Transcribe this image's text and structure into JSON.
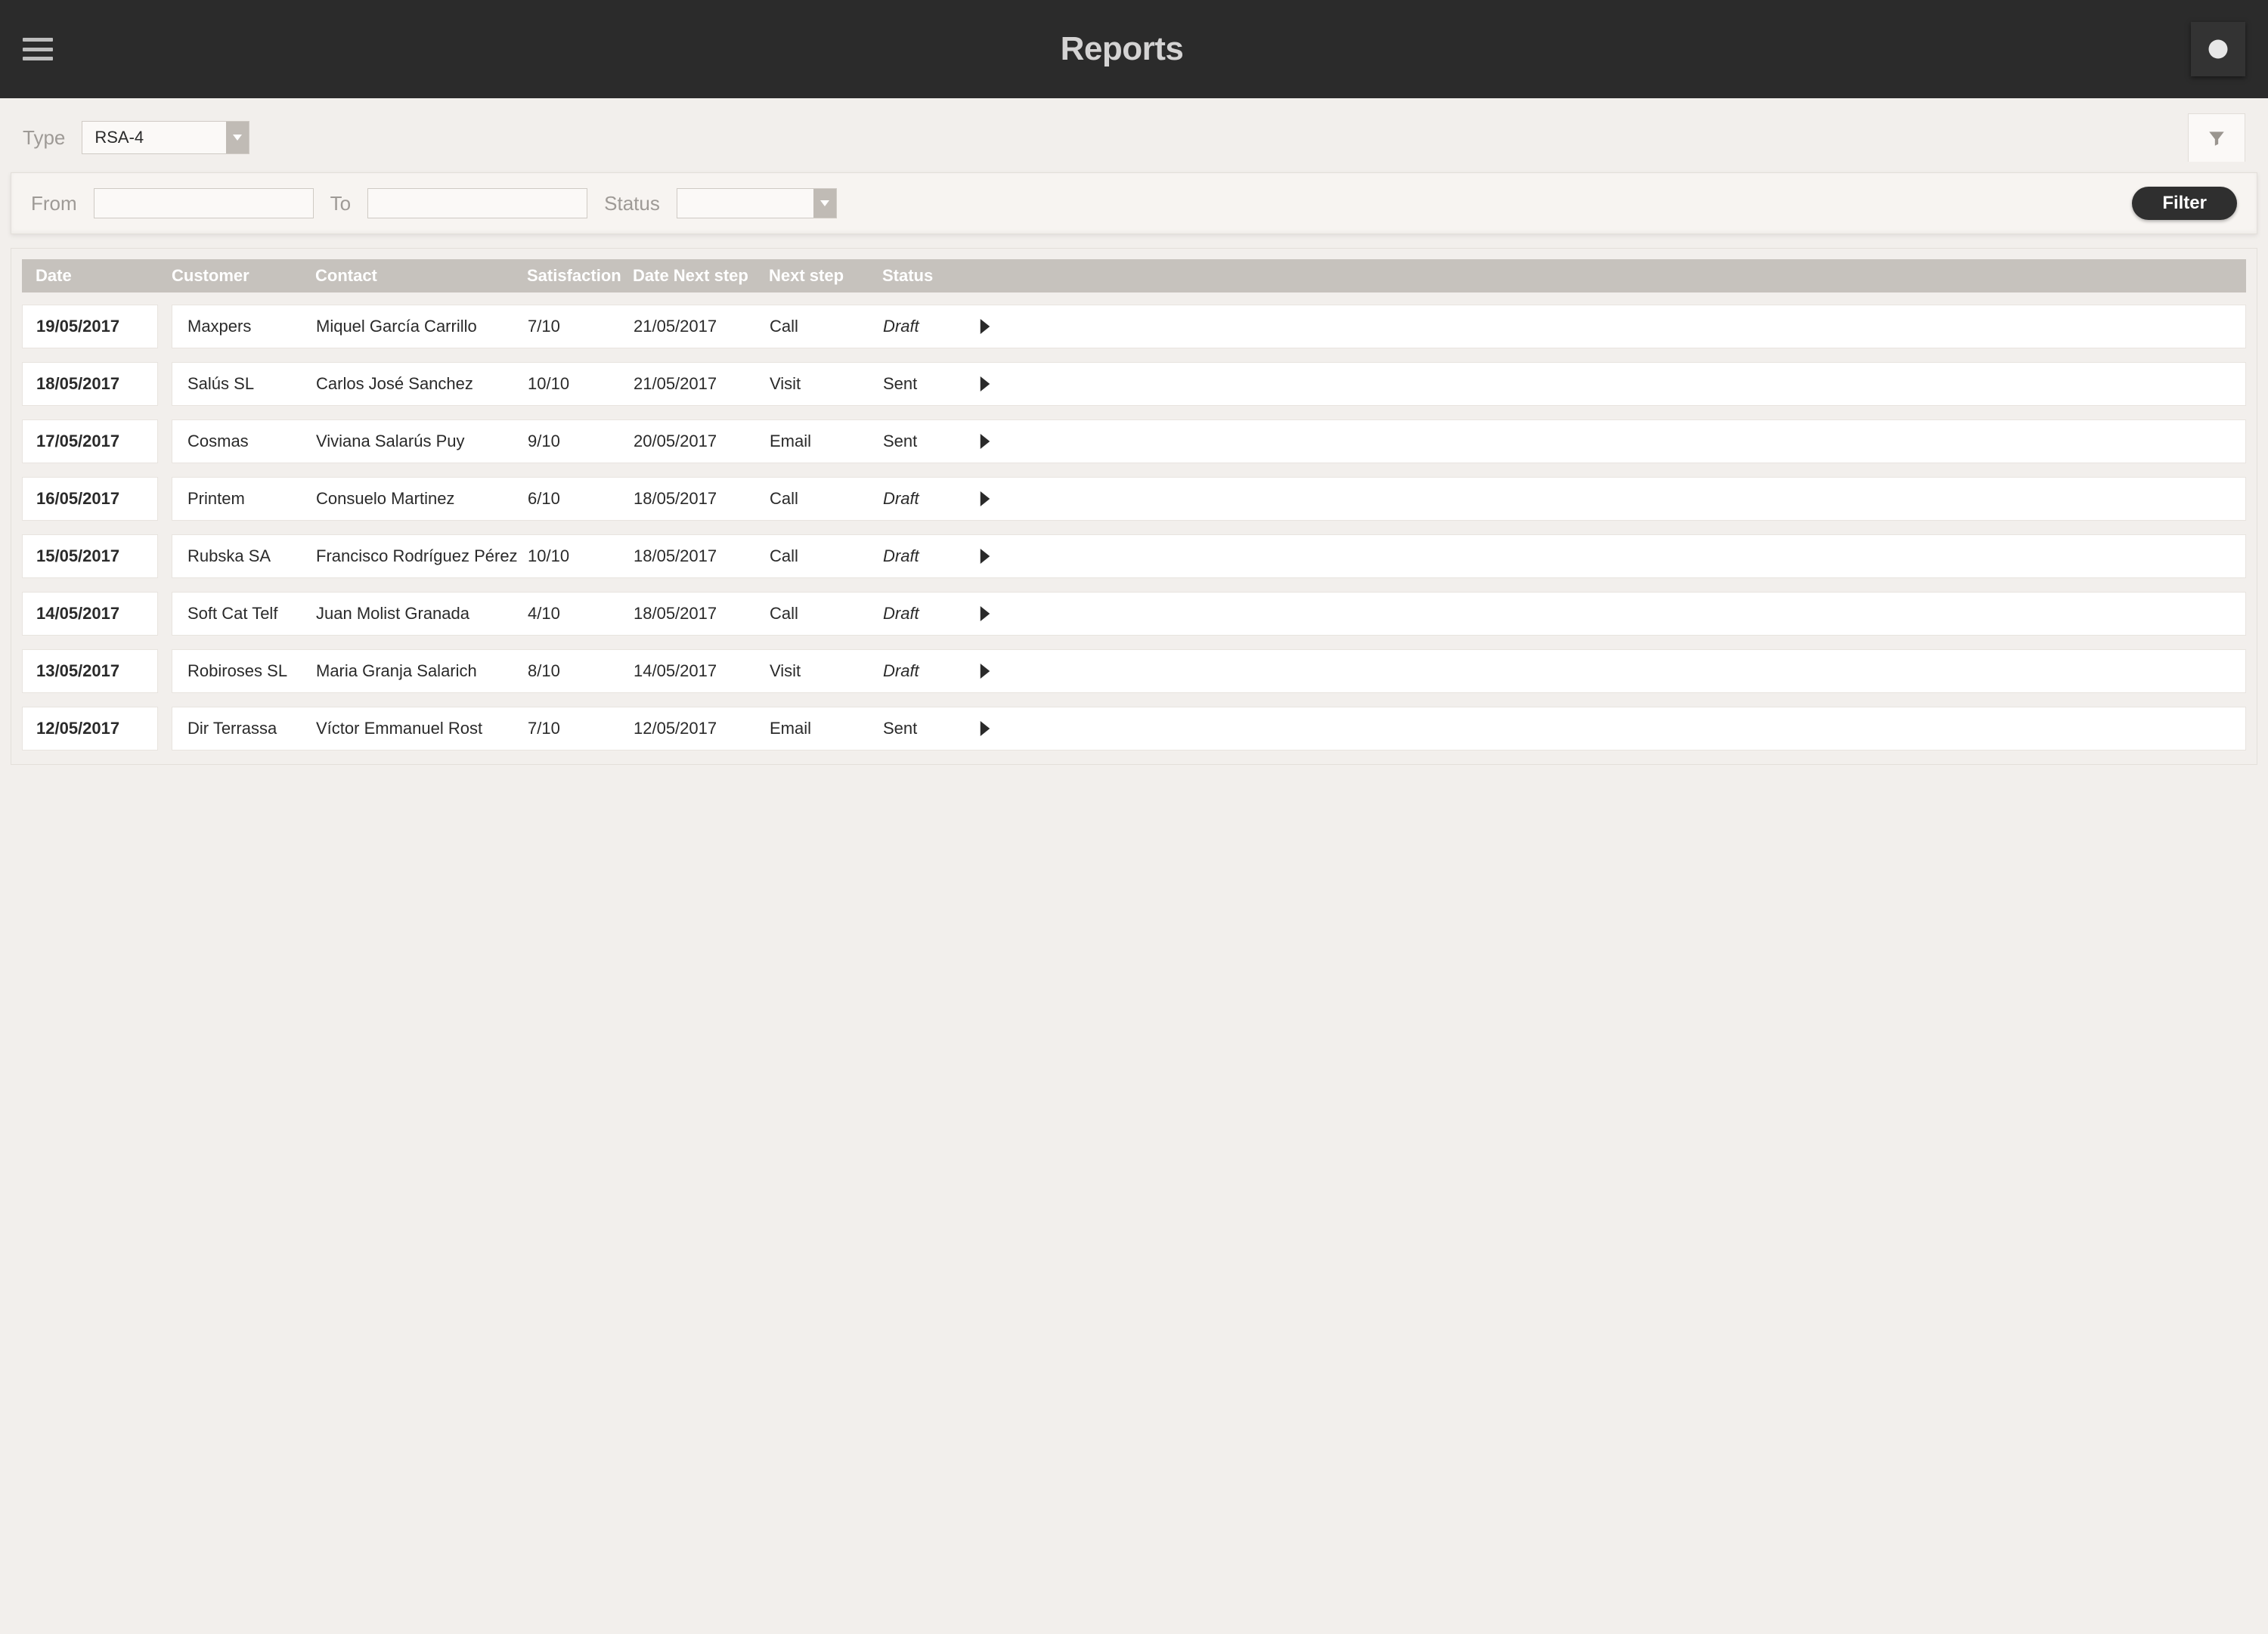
{
  "header": {
    "title": "Reports"
  },
  "type_bar": {
    "label": "Type",
    "value": "RSA-4"
  },
  "filters": {
    "from_label": "From",
    "from_value": "",
    "to_label": "To",
    "to_value": "",
    "status_label": "Status",
    "status_value": "",
    "filter_button": "Filter"
  },
  "columns": {
    "date": "Date",
    "customer": "Customer",
    "contact": "Contact",
    "satisfaction": "Satisfaction",
    "date_next": "Date Next step",
    "next_step": "Next step",
    "status": "Status"
  },
  "rows": [
    {
      "date": "19/05/2017",
      "customer": "Maxpers",
      "contact": "Miquel García Carrillo",
      "satisfaction": "7/10",
      "date_next": "21/05/2017",
      "next_step": "Call",
      "status": "Draft"
    },
    {
      "date": "18/05/2017",
      "customer": "Salús SL",
      "contact": "Carlos José Sanchez",
      "satisfaction": "10/10",
      "date_next": "21/05/2017",
      "next_step": "Visit",
      "status": "Sent"
    },
    {
      "date": "17/05/2017",
      "customer": "Cosmas",
      "contact": "Viviana Salarús Puy",
      "satisfaction": "9/10",
      "date_next": "20/05/2017",
      "next_step": "Email",
      "status": "Sent"
    },
    {
      "date": "16/05/2017",
      "customer": "Printem",
      "contact": "Consuelo Martinez",
      "satisfaction": "6/10",
      "date_next": "18/05/2017",
      "next_step": "Call",
      "status": "Draft"
    },
    {
      "date": "15/05/2017",
      "customer": "Rubska SA",
      "contact": "Francisco Rodríguez Pérez",
      "satisfaction": "10/10",
      "date_next": "18/05/2017",
      "next_step": "Call",
      "status": "Draft"
    },
    {
      "date": "14/05/2017",
      "customer": "Soft Cat Telf",
      "contact": "Juan Molist Granada",
      "satisfaction": "4/10",
      "date_next": "18/05/2017",
      "next_step": "Call",
      "status": "Draft"
    },
    {
      "date": "13/05/2017",
      "customer": "Robiroses SL",
      "contact": "Maria Granja Salarich",
      "satisfaction": "8/10",
      "date_next": "14/05/2017",
      "next_step": "Visit",
      "status": "Draft"
    },
    {
      "date": "12/05/2017",
      "customer": "Dir Terrassa",
      "contact": "Víctor Emmanuel Rost",
      "satisfaction": "7/10",
      "date_next": "12/05/2017",
      "next_step": "Email",
      "status": "Sent"
    }
  ]
}
